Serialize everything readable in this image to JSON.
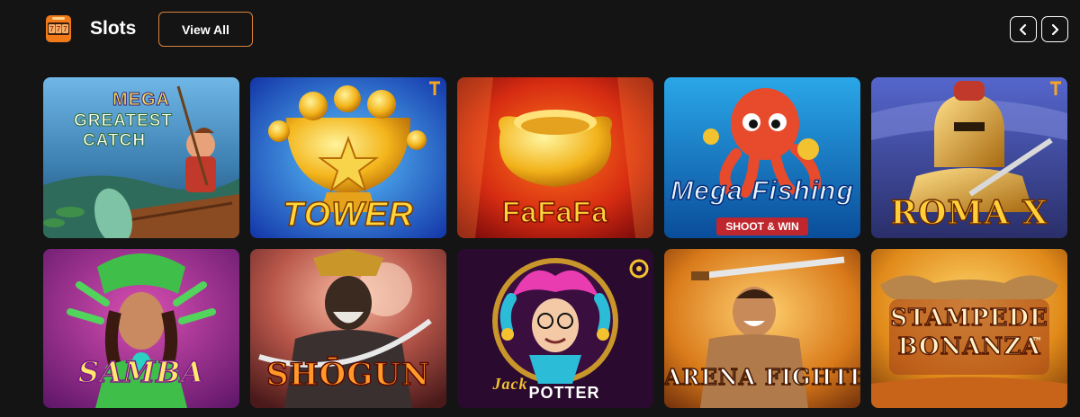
{
  "section": {
    "title": "Slots",
    "icon": "slot-machine-777-icon",
    "view_all_label": "View All",
    "accent": "#d9823b"
  },
  "nav": {
    "prev_icon": "chevron-left-icon",
    "next_icon": "chevron-right-icon"
  },
  "games": [
    {
      "logo_line1": "MEGA",
      "logo_line2": "GREATEST",
      "logo_line3": "CATCH",
      "art": "fisherman-boat-fish-art"
    },
    {
      "logo": "TOWER",
      "badge": "T",
      "art": "golden-trophy-coins-art"
    },
    {
      "logo": "FaFaFa",
      "art": "gold-ingot-art"
    },
    {
      "logo": "Mega Fishing",
      "sub": "SHOOT & WIN",
      "art": "octopus-art"
    },
    {
      "logo": "ROMA X",
      "badge": "T",
      "art": "roman-gladiator-art"
    },
    {
      "logo": "SAMBA",
      "art": "carnival-dancer-art"
    },
    {
      "logo": "SHŌGUN",
      "art": "samurai-warrior-art"
    },
    {
      "logo_line1": "Jack",
      "logo_line2": "POTTER",
      "art": "jester-art"
    },
    {
      "logo": "ARENA FIGHTER",
      "art": "gladiator-sword-art"
    },
    {
      "logo_line1": "STAMPEDE",
      "logo_line2": "BONANZA",
      "tm": "™",
      "art": "bull-horns-art"
    }
  ]
}
